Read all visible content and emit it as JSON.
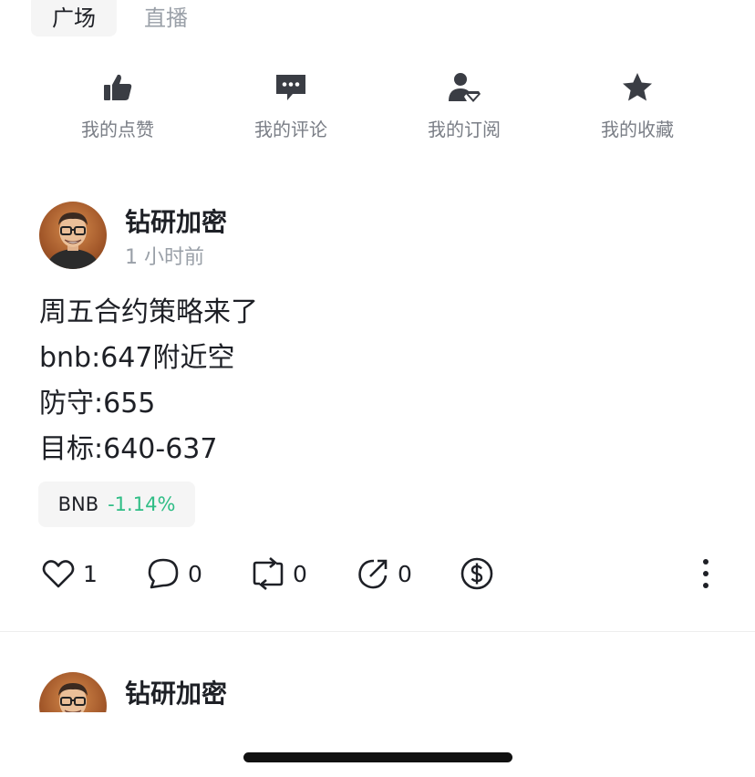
{
  "tabs": {
    "square": "广场",
    "live": "直播"
  },
  "quick_actions": [
    {
      "label": "我的点赞",
      "icon": "thumbs-up-icon"
    },
    {
      "label": "我的评论",
      "icon": "comment-icon"
    },
    {
      "label": "我的订阅",
      "icon": "subscription-icon"
    },
    {
      "label": "我的收藏",
      "icon": "star-icon"
    }
  ],
  "posts": [
    {
      "author": "钻研加密",
      "time": "1 小时前",
      "lines": [
        "周五合约策略来了",
        "bnb:647附近空",
        "防守:655",
        "目标:640-637"
      ],
      "coin": {
        "symbol": "BNB",
        "change": "-1.14%"
      },
      "stats": {
        "likes": "1",
        "comments": "0",
        "reposts": "0",
        "shares": "0"
      }
    },
    {
      "author": "钻研加密"
    }
  ],
  "colors": {
    "text": "#1e2026",
    "muted": "#9aa0a8",
    "positive_change": "#2ebd85",
    "tag_bg": "#f5f5f5"
  }
}
